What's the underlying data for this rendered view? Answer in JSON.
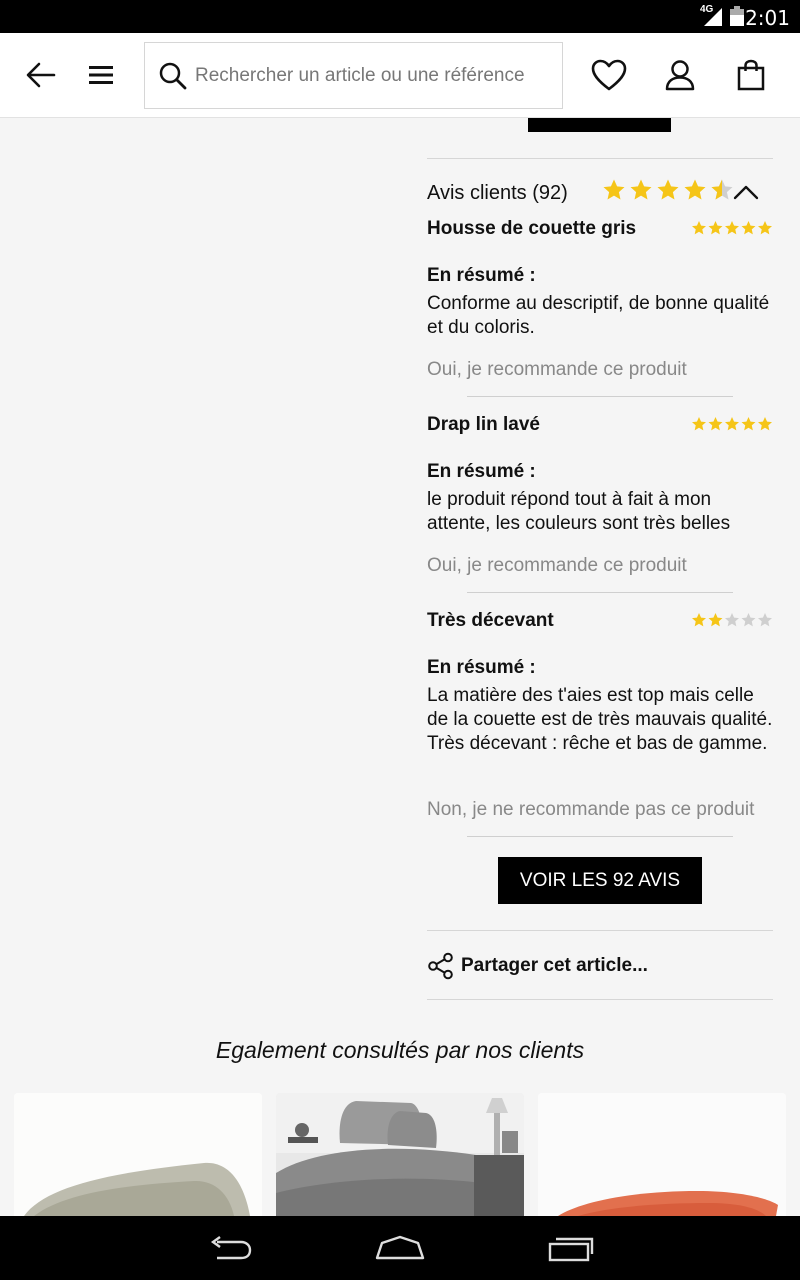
{
  "status": {
    "network": "4G",
    "time": "2:01"
  },
  "appbar": {
    "back_icon": "arrow-left-icon",
    "menu_icon": "hamburger-menu-icon",
    "search_placeholder": "Rechercher un article ou une référence",
    "wishlist_icon": "heart-icon",
    "account_icon": "user-icon",
    "cart_icon": "shopping-bag-icon"
  },
  "reviews_section": {
    "title": "Avis clients (92)",
    "rating": 4.5,
    "rating_max": 5,
    "star_color": "#f5c518",
    "reviews": [
      {
        "title": "Housse de couette gris",
        "rating": 5,
        "summary_label": "En résumé :",
        "text": "Conforme au descriptif, de bonne qualité et du coloris.",
        "recommend": "Oui, je recommande ce produit"
      },
      {
        "title": "Drap lin lavé",
        "rating": 5,
        "summary_label": "En résumé :",
        "text": "le produit répond tout à fait à mon attente, les couleurs sont très belles",
        "recommend": "Oui, je recommande ce produit"
      },
      {
        "title": "Très décevant",
        "rating": 2,
        "summary_label": "En résumé :",
        "text": "La matière des t'aies est top mais celle de la couette est de très mauvais qualité. Très décevant : rêche et bas de gamme.",
        "recommend": "Non, je ne recommande pas ce produit"
      }
    ],
    "see_all_label": "VOIR LES 92 AVIS"
  },
  "share": {
    "label": "Partager cet article..."
  },
  "also_viewed": {
    "title": "Egalement consultés par nos clients"
  }
}
